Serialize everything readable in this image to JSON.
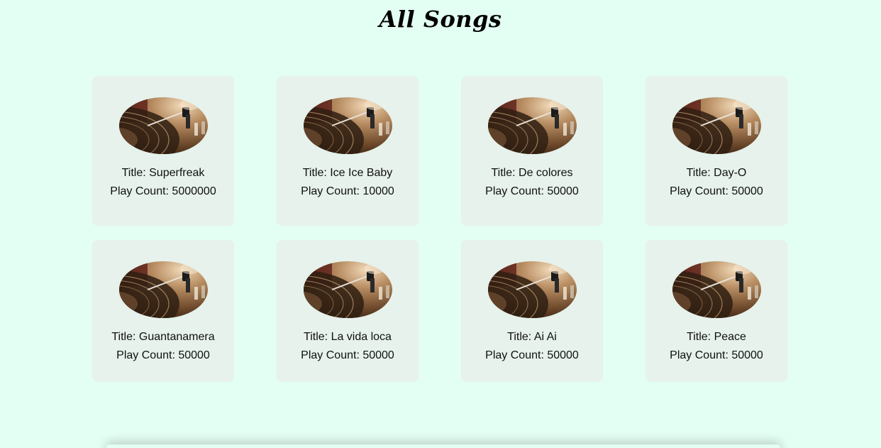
{
  "header": {
    "title": "All Songs"
  },
  "labels": {
    "title_prefix": "Title: ",
    "count_prefix": "Play Count: "
  },
  "colors": {
    "background": "#e3fef3",
    "card": "#e6f2eb"
  },
  "cover_icon": "vinyl-turntable-image",
  "songs": [
    {
      "title": "Superfreak",
      "play_count": "5000000"
    },
    {
      "title": "Ice Ice Baby",
      "play_count": "10000"
    },
    {
      "title": "De colores",
      "play_count": "50000"
    },
    {
      "title": "Day-O",
      "play_count": "50000"
    },
    {
      "title": "Guantanamera",
      "play_count": "50000"
    },
    {
      "title": "La vida loca",
      "play_count": "50000"
    },
    {
      "title": "Ai Ai",
      "play_count": "50000"
    },
    {
      "title": "Peace",
      "play_count": "50000"
    }
  ]
}
